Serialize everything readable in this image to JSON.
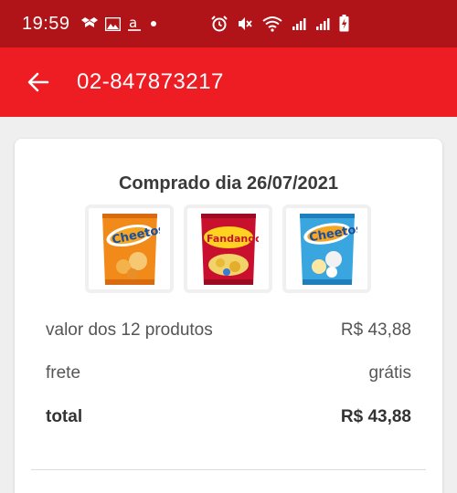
{
  "status_bar": {
    "time": "19:59",
    "left_icons": [
      "dropbox-icon",
      "gallery-icon",
      "amazon-icon",
      "dot-icon"
    ],
    "right_icons": [
      "alarm-icon",
      "mute-icon",
      "wifi-icon",
      "signal-icon",
      "signal-icon",
      "battery-icon"
    ]
  },
  "app_bar": {
    "title": "02-847873217",
    "back_icon": "arrow-left-icon"
  },
  "order": {
    "purchase_date": "Comprado dia 26/07/2021",
    "products": [
      {
        "name": "Cheetos"
      },
      {
        "name": "Fandangos"
      },
      {
        "name": "Cheetos"
      }
    ],
    "summary": {
      "items_label": "valor dos 12 produtos",
      "items_value": "R$ 43,88",
      "shipping_label": "frete",
      "shipping_value": "grátis",
      "total_label": "total",
      "total_value": "R$ 43,88"
    }
  },
  "colors": {
    "status_bar": "#b01418",
    "app_bar": "#ee1d23",
    "background": "#efefef"
  }
}
